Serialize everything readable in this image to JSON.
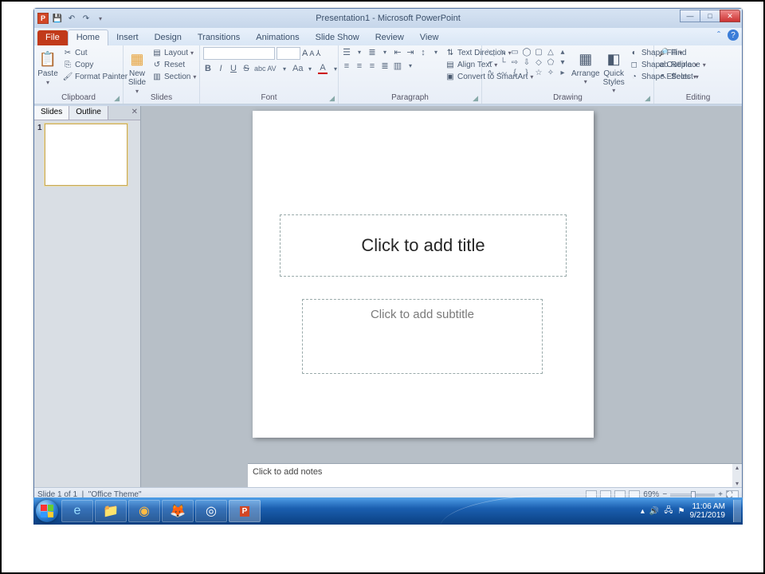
{
  "title": "Presentation1 - Microsoft PowerPoint",
  "qat": {
    "save": "💾",
    "undo": "↶",
    "redo": "↷",
    "more": "▾"
  },
  "tabs": {
    "file": "File",
    "items": [
      "Home",
      "Insert",
      "Design",
      "Transitions",
      "Animations",
      "Slide Show",
      "Review",
      "View"
    ],
    "active": "Home"
  },
  "ribbon": {
    "clipboard": {
      "label": "Clipboard",
      "paste": "Paste",
      "cut": "Cut",
      "copy": "Copy",
      "format_painter": "Format Painter"
    },
    "slides": {
      "label": "Slides",
      "new_slide": "New\nSlide",
      "layout": "Layout",
      "reset": "Reset",
      "section": "Section"
    },
    "font": {
      "label": "Font",
      "name": "",
      "size": "",
      "grow": "A",
      "shrink": "A",
      "clear": "⌫",
      "bold": "B",
      "italic": "I",
      "underline": "U",
      "strike": "S",
      "shadow": "abc",
      "spacing": "AV",
      "case": "Aa",
      "color": "A"
    },
    "paragraph": {
      "label": "Paragraph",
      "text_direction": "Text Direction",
      "align_text": "Align Text",
      "convert": "Convert to SmartArt"
    },
    "drawing": {
      "label": "Drawing",
      "arrange": "Arrange",
      "quick_styles": "Quick\nStyles",
      "shape_fill": "Shape Fill",
      "shape_outline": "Shape Outline",
      "shape_effects": "Shape Effects"
    },
    "editing": {
      "label": "Editing",
      "find": "Find",
      "replace": "Replace",
      "select": "Select"
    }
  },
  "sidepane": {
    "tabs": {
      "slides": "Slides",
      "outline": "Outline"
    },
    "slide_numbers": [
      "1"
    ]
  },
  "slide": {
    "title_placeholder": "Click to add title",
    "subtitle_placeholder": "Click to add subtitle"
  },
  "notes_placeholder": "Click to add notes",
  "status": {
    "left": "Slide 1 of 1",
    "theme": "\"Office Theme\"",
    "zoom": "69%"
  },
  "taskbar": {
    "time": "11:06 AM",
    "date": "9/21/2019"
  }
}
